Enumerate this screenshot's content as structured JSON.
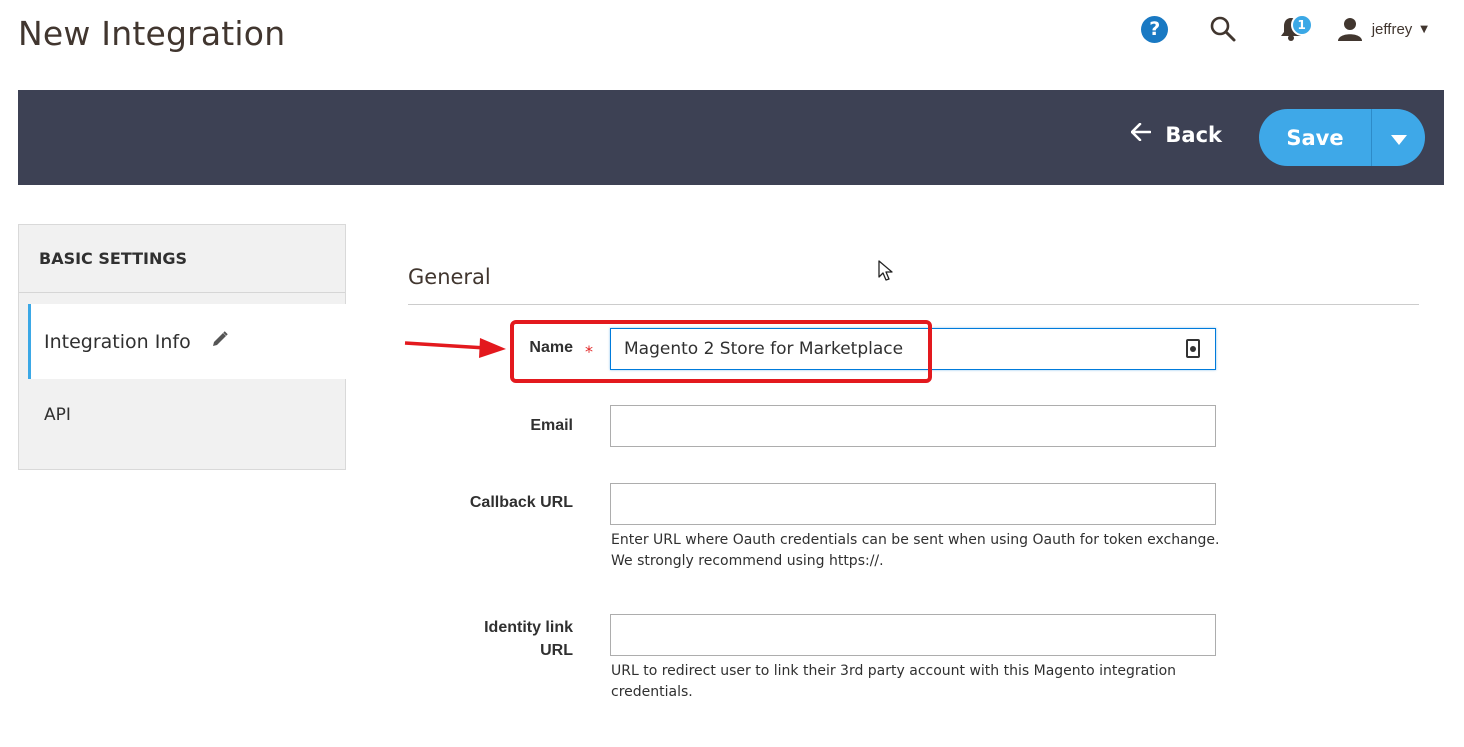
{
  "header": {
    "title": "New Integration",
    "help_label": "?",
    "notifications_count": "1",
    "user_name": "jeffrey"
  },
  "action_bar": {
    "back_label": "Back",
    "save_label": "Save"
  },
  "sidebar": {
    "title": "BASIC SETTINGS",
    "items": [
      {
        "label": "Integration Info"
      },
      {
        "label": "API"
      }
    ]
  },
  "form": {
    "section_title": "General",
    "fields": {
      "name": {
        "label": "Name",
        "required_mark": "*",
        "value": "Magento 2 Store for Marketplace"
      },
      "email": {
        "label": "Email",
        "value": ""
      },
      "callback_url": {
        "label": "Callback URL",
        "value": "",
        "note_line1": "Enter URL where Oauth credentials can be sent when using Oauth for token exchange.",
        "note_line2": "We strongly recommend using https://."
      },
      "identity_link_url": {
        "label_line1": "Identity link",
        "label_line2": "URL",
        "value": "",
        "note_line1": "URL to redirect user to link their 3rd party account with this Magento integration",
        "note_line2": "credentials."
      }
    }
  },
  "colors": {
    "action_bar_bg": "#3d4154",
    "save_button": "#3ea8e8",
    "accent_blue": "#1979c3",
    "annotation_red": "#e3191e"
  }
}
